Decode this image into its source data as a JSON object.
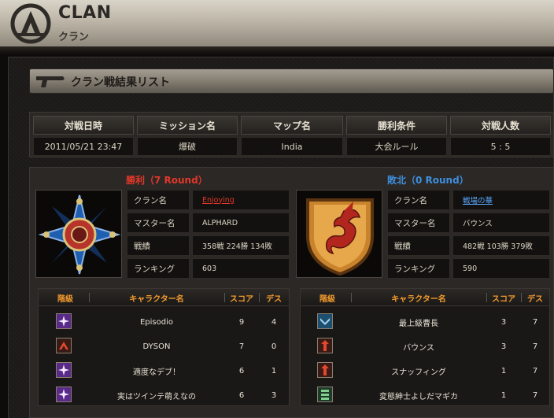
{
  "header": {
    "title": "CLAN",
    "subtitle": "クラン"
  },
  "section": {
    "title": "クラン戦結果リスト"
  },
  "info": {
    "headers": [
      "対戦日時",
      "ミッション名",
      "マップ名",
      "勝利条件",
      "対戦人数"
    ],
    "values": [
      "2011/05/21 23:47",
      "爆破",
      "India",
      "大会ルール",
      "5 : 5"
    ]
  },
  "winner": {
    "result": "勝利（7 Round）",
    "rows": [
      {
        "label": "クラン名",
        "value": "Enjoying"
      },
      {
        "label": "マスター名",
        "value": "ALPHARD"
      },
      {
        "label": "戦績",
        "value": "358戦 224勝 134敗"
      },
      {
        "label": "ランキング",
        "value": "603"
      }
    ],
    "member_headers": [
      "階級",
      "キャラクター名",
      "スコア",
      "デス"
    ],
    "members": [
      {
        "name": "Episodio",
        "score": "9",
        "death": "4",
        "rank_icon": "purple-star-rank-icon"
      },
      {
        "name": "DYSON",
        "score": "7",
        "death": "0",
        "rank_icon": "red-chevron-rank-icon"
      },
      {
        "name": "適度なデブ！",
        "score": "6",
        "death": "1",
        "rank_icon": "purple-star-rank-icon"
      },
      {
        "name": "実はツインテ萌えなの",
        "score": "6",
        "death": "3",
        "rank_icon": "purple-star-rank-icon"
      }
    ]
  },
  "loser": {
    "result": "敗北（0 Round）",
    "rows": [
      {
        "label": "クラン名",
        "value": "戦場の華"
      },
      {
        "label": "マスター名",
        "value": "バウンス"
      },
      {
        "label": "戦績",
        "value": "482戦 103勝 379敗"
      },
      {
        "label": "ランキング",
        "value": "590"
      }
    ],
    "member_headers": [
      "階級",
      "キャラクター名",
      "スコア",
      "デス"
    ],
    "members": [
      {
        "name": "最上級曹長",
        "score": "3",
        "death": "7",
        "rank_icon": "blue-chevron-rank-icon"
      },
      {
        "name": "バウンス",
        "score": "3",
        "death": "7",
        "rank_icon": "red-bars-rank-icon"
      },
      {
        "name": "スナッフィング",
        "score": "1",
        "death": "7",
        "rank_icon": "red-bars-rank-icon"
      },
      {
        "name": "変態紳士よしだマギカ",
        "score": "1",
        "death": "7",
        "rank_icon": "green-bars-rank-icon"
      }
    ]
  },
  "colors": {
    "win": "#e2382a",
    "lose": "#3e8fe0",
    "header_orange": "#f39a2e"
  }
}
